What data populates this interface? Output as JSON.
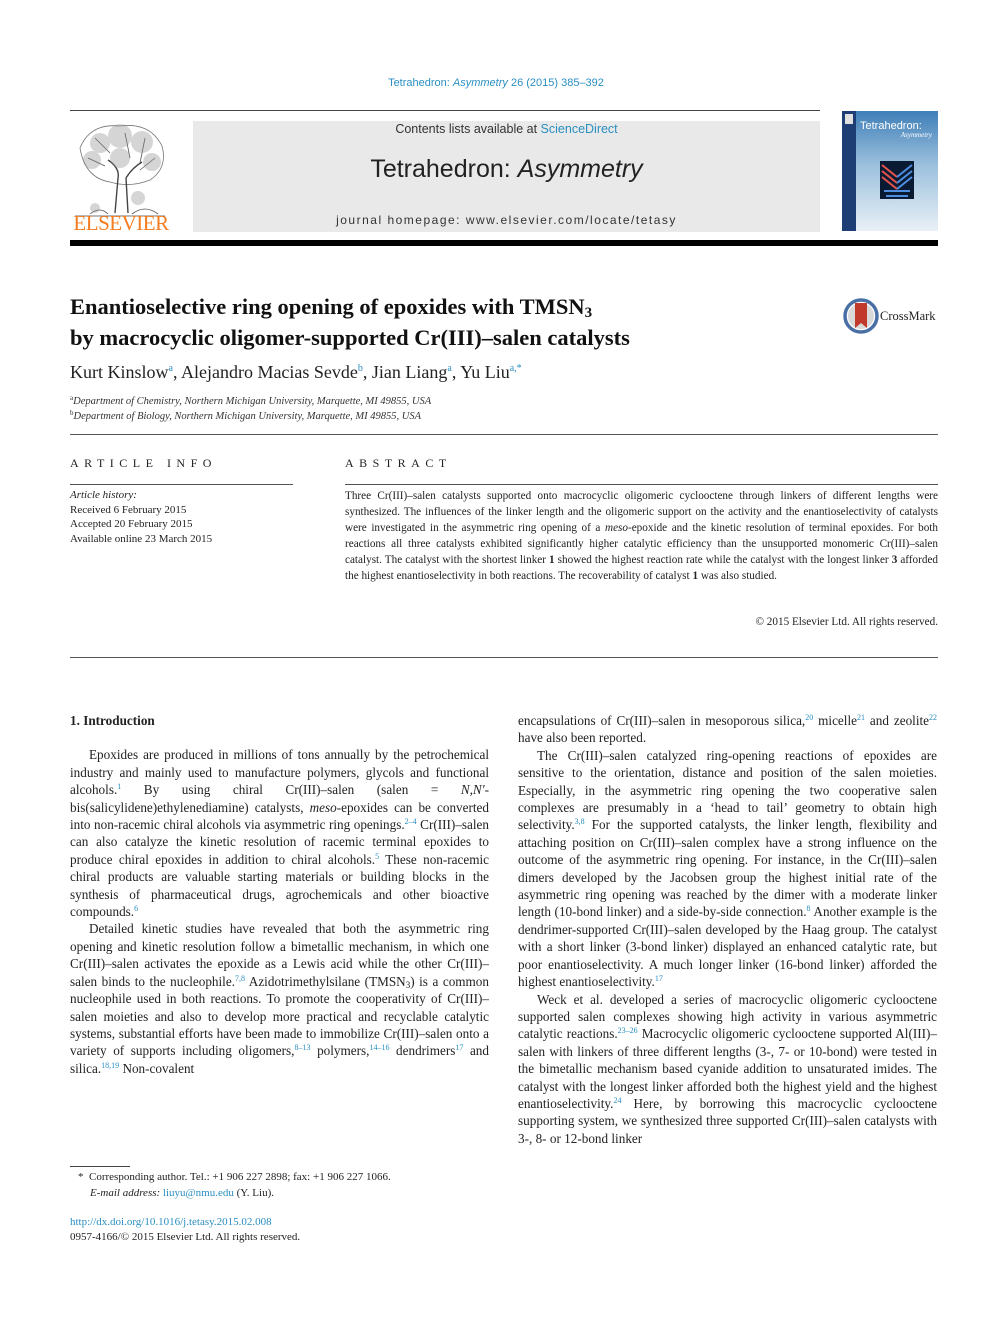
{
  "header": {
    "citation": {
      "journal": "Tetrahedron: ",
      "journal_italic": "Asymmetry",
      "volume_pages": " 26 (2015) 385–392"
    },
    "contents_prefix": "Contents lists available at ",
    "contents_link": "ScienceDirect",
    "journal_title_plain": "Tetrahedron: ",
    "journal_title_italic": "Asymmetry",
    "homepage": "journal homepage: www.elsevier.com/locate/tetasy",
    "publisher_logo_text": "ELSEVIER",
    "cover_title": "Tetrahedron:",
    "cover_subtitle": "Asymmetry",
    "brand_colors": {
      "elsevier_orange": "#f47c20",
      "link_blue": "#2a8fc1",
      "cover_blue": "#1c3e74"
    }
  },
  "article": {
    "title_line1": "Enantioselective ring opening of epoxides with TMSN",
    "title_line1_sub": "3",
    "title_line2": "by macrocyclic oligomer-supported Cr(III)–salen catalysts",
    "crossmark_label": "CrossMark",
    "authors": [
      {
        "name": "Kurt Kinslow",
        "affil": "a",
        "sep": ", "
      },
      {
        "name": "Alejandro Macias Sevde",
        "affil": "b",
        "sep": ", "
      },
      {
        "name": "Jian Liang",
        "affil": "a",
        "sep": ", "
      },
      {
        "name": "Yu Liu",
        "affil": "a,*",
        "sep": ""
      }
    ],
    "affiliations": [
      {
        "key": "a",
        "text": "Department of Chemistry, Northern Michigan University, Marquette, MI 49855, USA"
      },
      {
        "key": "b",
        "text": "Department of Biology, Northern Michigan University, Marquette, MI 49855, USA"
      }
    ]
  },
  "article_info": {
    "heading": "ARTICLE INFO",
    "history_label": "Article history:",
    "received": "Received 6 February 2015",
    "accepted": "Accepted 20 February 2015",
    "online": "Available online 23 March 2015"
  },
  "abstract": {
    "heading": "ABSTRACT",
    "p1": "Three Cr(III)–salen catalysts supported onto macrocyclic oligomeric cyclooctene through linkers of different lengths were synthesized. The influences of the linker length and the oligomeric support on the activity and the enantioselectivity of catalysts were investigated in the asymmetric ring opening of a ",
    "meso": "meso",
    "p2": "-epoxide and the kinetic resolution of terminal epoxides. For both reactions all three catalysts exhibited significantly higher catalytic efficiency than the unsupported monomeric Cr(III)–salen catalyst. The catalyst with the shortest linker ",
    "bold1": "1",
    "p3": " showed the highest reaction rate while the catalyst with the longest linker ",
    "bold3": "3",
    "p4": " afforded the highest enantioselectivity in both reactions. The recoverability of catalyst ",
    "bold1b": "1",
    "p5": " was also studied.",
    "copyright": "© 2015 Elsevier Ltd. All rights reserved."
  },
  "body": {
    "section_heading": "1. Introduction",
    "left": {
      "para1": [
        {
          "t": "Epoxides are produced in millions of tons annually by the petrochemical industry and mainly used to manufacture polymers, glycols and functional alcohols."
        },
        {
          "ref": "1"
        },
        {
          "t": " By using chiral Cr(III)–salen (salen = "
        },
        {
          "i": "N,N′"
        },
        {
          "t": "-bis(salicylidene)ethylenediamine) catalysts, "
        },
        {
          "i": "meso"
        },
        {
          "t": "-epoxides can be converted into non-racemic chiral alcohols via asymmetric ring openings."
        },
        {
          "ref": "2–4"
        },
        {
          "t": " Cr(III)–salen can also catalyze the kinetic resolution of racemic terminal epoxides to produce chiral epoxides in addition to chiral alcohols."
        },
        {
          "ref": "5"
        },
        {
          "t": " These non-racemic chiral products are valuable starting materials or building blocks in the synthesis of pharmaceutical drugs, agrochemicals and other bioactive compounds."
        },
        {
          "ref": "6"
        }
      ],
      "para2": [
        {
          "t": "Detailed kinetic studies have revealed that both the asymmetric ring opening and kinetic resolution follow a bimetallic mechanism, in which one Cr(III)–salen activates the epoxide as a Lewis acid while the other Cr(III)–salen binds to the nucleophile."
        },
        {
          "ref": "7,8"
        },
        {
          "t": " Azidotrimethylsilane (TMSN"
        },
        {
          "sub": "3"
        },
        {
          "t": ") is a common nucleophile used in both reactions. To promote the cooperativity of Cr(III)–salen moieties and also to develop more practical and recyclable catalytic systems, substantial efforts have been made to immobilize Cr(III)–salen onto a variety of supports including oligomers,"
        },
        {
          "ref": "8–13"
        },
        {
          "t": " polymers,"
        },
        {
          "ref": "14–16"
        },
        {
          "t": " dendrimers"
        },
        {
          "ref": "17"
        },
        {
          "t": " and silica."
        },
        {
          "ref": "18,19"
        },
        {
          "t": " Non-covalent"
        }
      ]
    },
    "right": {
      "para0": [
        {
          "t": "encapsulations of Cr(III)–salen in mesoporous silica,"
        },
        {
          "ref": "20"
        },
        {
          "t": " micelle"
        },
        {
          "ref": "21"
        },
        {
          "t": " and zeolite"
        },
        {
          "ref": "22"
        },
        {
          "t": " have also been reported."
        }
      ],
      "para1": [
        {
          "t": "The Cr(III)–salen catalyzed ring-opening reactions of epoxides are sensitive to the orientation, distance and position of the salen moieties. Especially, in the asymmetric ring opening the two cooperative salen complexes are presumably in a ‘head to tail’ geometry to obtain high selectivity."
        },
        {
          "ref": "3,8"
        },
        {
          "t": " For the supported catalysts, the linker length, flexibility and attaching position on Cr(III)–salen complex have a strong influence on the outcome of the asymmetric ring opening. For instance, in the Cr(III)–salen dimers developed by the Jacobsen group the highest initial rate of the asymmetric ring opening was reached by the dimer with a moderate linker length (10-bond linker) and a side-by-side connection."
        },
        {
          "ref": "8"
        },
        {
          "t": " Another example is the dendrimer-supported Cr(III)–salen developed by the Haag group. The catalyst with a short linker (3-bond linker) displayed an enhanced catalytic rate, but poor enantioselectivity. A much longer linker (16-bond linker) afforded the highest enantioselectivity."
        },
        {
          "ref": "17"
        }
      ],
      "para2": [
        {
          "t": "Weck et al. developed a series of macrocyclic oligomeric cyclooctene supported salen complexes showing high activity in various asymmetric catalytic reactions."
        },
        {
          "ref": "23–26"
        },
        {
          "t": " Macrocyclic oligomeric cyclooctene supported Al(III)–salen with linkers of three different lengths (3-, 7- or 10-bond) were tested in the bimetallic mechanism based cyanide addition to unsaturated imides. The catalyst with the longest linker afforded both the highest yield and the highest enantioselectivity."
        },
        {
          "ref": "24"
        },
        {
          "t": " Here, by borrowing this macrocyclic cyclooctene supporting system, we synthesized three supported Cr(III)–salen catalysts with 3-, 8- or 12-bond linker"
        }
      ]
    }
  },
  "footnotes": {
    "star": "*",
    "corresponding": "Corresponding author. Tel.: +1 906 227 2898; fax: +1 906 227 1066.",
    "email_label": "E-mail address: ",
    "email": "liuyu@nmu.edu",
    "email_suffix": " (Y. Liu).",
    "doi": "http://dx.doi.org/10.1016/j.tetasy.2015.02.008",
    "issn": "0957-4166/© 2015 Elsevier Ltd. All rights reserved."
  }
}
